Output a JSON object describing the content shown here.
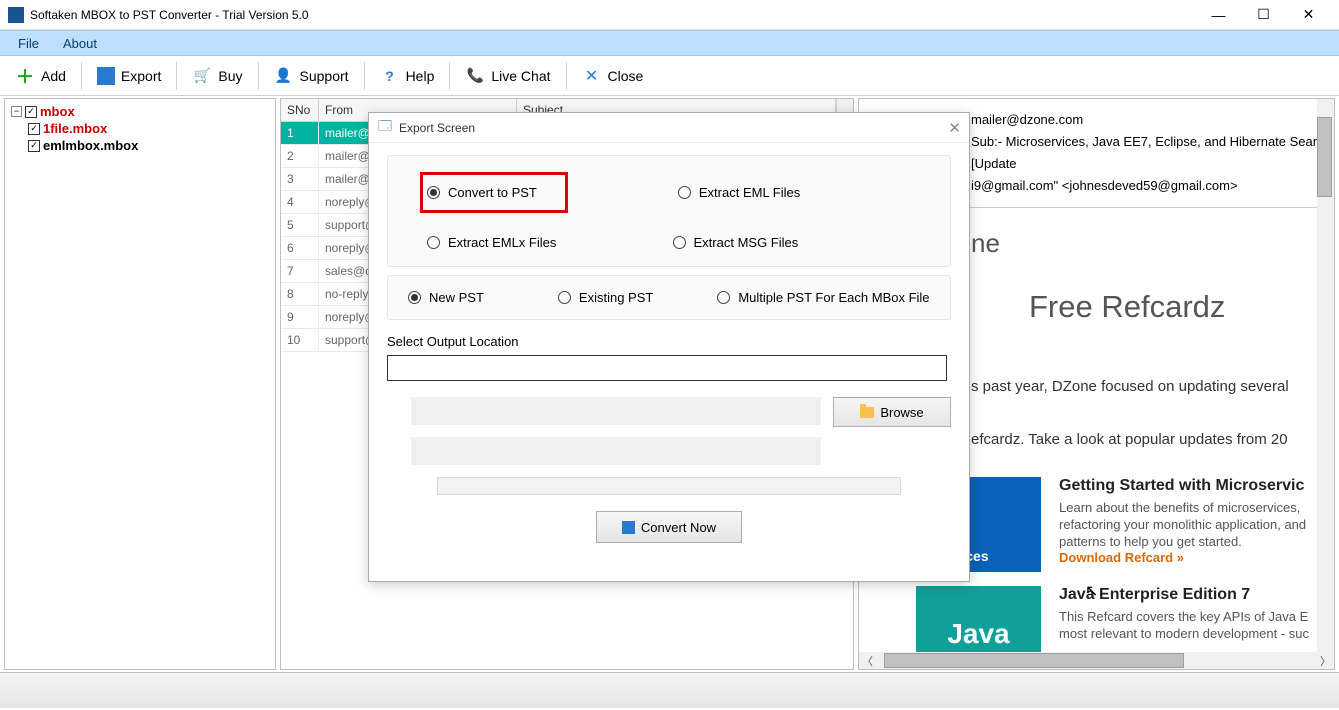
{
  "window": {
    "title": "Softaken MBOX to PST Converter - Trial Version 5.0"
  },
  "menu": {
    "file": "File",
    "about": "About"
  },
  "toolbar": {
    "add": "Add",
    "export": "Export",
    "buy": "Buy",
    "support": "Support",
    "help": "Help",
    "livechat": "Live Chat",
    "close": "Close"
  },
  "tree": {
    "root": "mbox",
    "children": [
      {
        "label": "1file.mbox",
        "color": "#c00"
      },
      {
        "label": "emlmbox.mbox",
        "color": "#000"
      }
    ]
  },
  "list": {
    "cols": {
      "sno": "SNo",
      "from": "From",
      "subject": "Subject"
    },
    "rows": [
      {
        "sno": "1",
        "from": "mailer@d",
        "selected": true
      },
      {
        "sno": "2",
        "from": "mailer@d"
      },
      {
        "sno": "3",
        "from": "mailer@d"
      },
      {
        "sno": "4",
        "from": "noreply@"
      },
      {
        "sno": "5",
        "from": "support@"
      },
      {
        "sno": "6",
        "from": "noreply@"
      },
      {
        "sno": "7",
        "from": "sales@cit"
      },
      {
        "sno": "8",
        "from": "no-reply@"
      },
      {
        "sno": "9",
        "from": "noreply@"
      },
      {
        "sno": "10",
        "from": "support@"
      }
    ]
  },
  "preview": {
    "from_line": "mailer@dzone.com",
    "sub_line": "Sub:- Microservices, Java EE7, Eclipse, and Hibernate Search [Update",
    "to_line": "i9@gmail.com\" <johnesdeved59@gmail.com>",
    "ne_fragment": "ne",
    "refcardz_title": "Free Refcardz",
    "intro1": "s past year, DZone focused on updating several",
    "intro2": "efcardz. Take a look at popular updates from 20",
    "card1_title": "Getting Started with Microservic",
    "card1_body": "Learn about the benefits of microservices,\nrefactoring your monolithic application, and\npatterns to help you get started.",
    "card1_link": "Download Refcard »",
    "card1_img": "oservices",
    "card2_title": "Java Enterprise Edition 7",
    "card2_body": "This Refcard covers the key APIs of Java E\nmost relevant to modern development - suc",
    "card2_img": "Java"
  },
  "dialog": {
    "title": "Export Screen",
    "opt_pst": "Convert to PST",
    "opt_eml": "Extract EML Files",
    "opt_emlx": "Extract EMLx Files",
    "opt_msg": "Extract MSG Files",
    "pst_new": "New PST",
    "pst_existing": "Existing PST",
    "pst_multi": "Multiple PST For Each MBox File",
    "sel_label": "Select Output Location",
    "browse": "Browse",
    "convert": "Convert Now"
  }
}
